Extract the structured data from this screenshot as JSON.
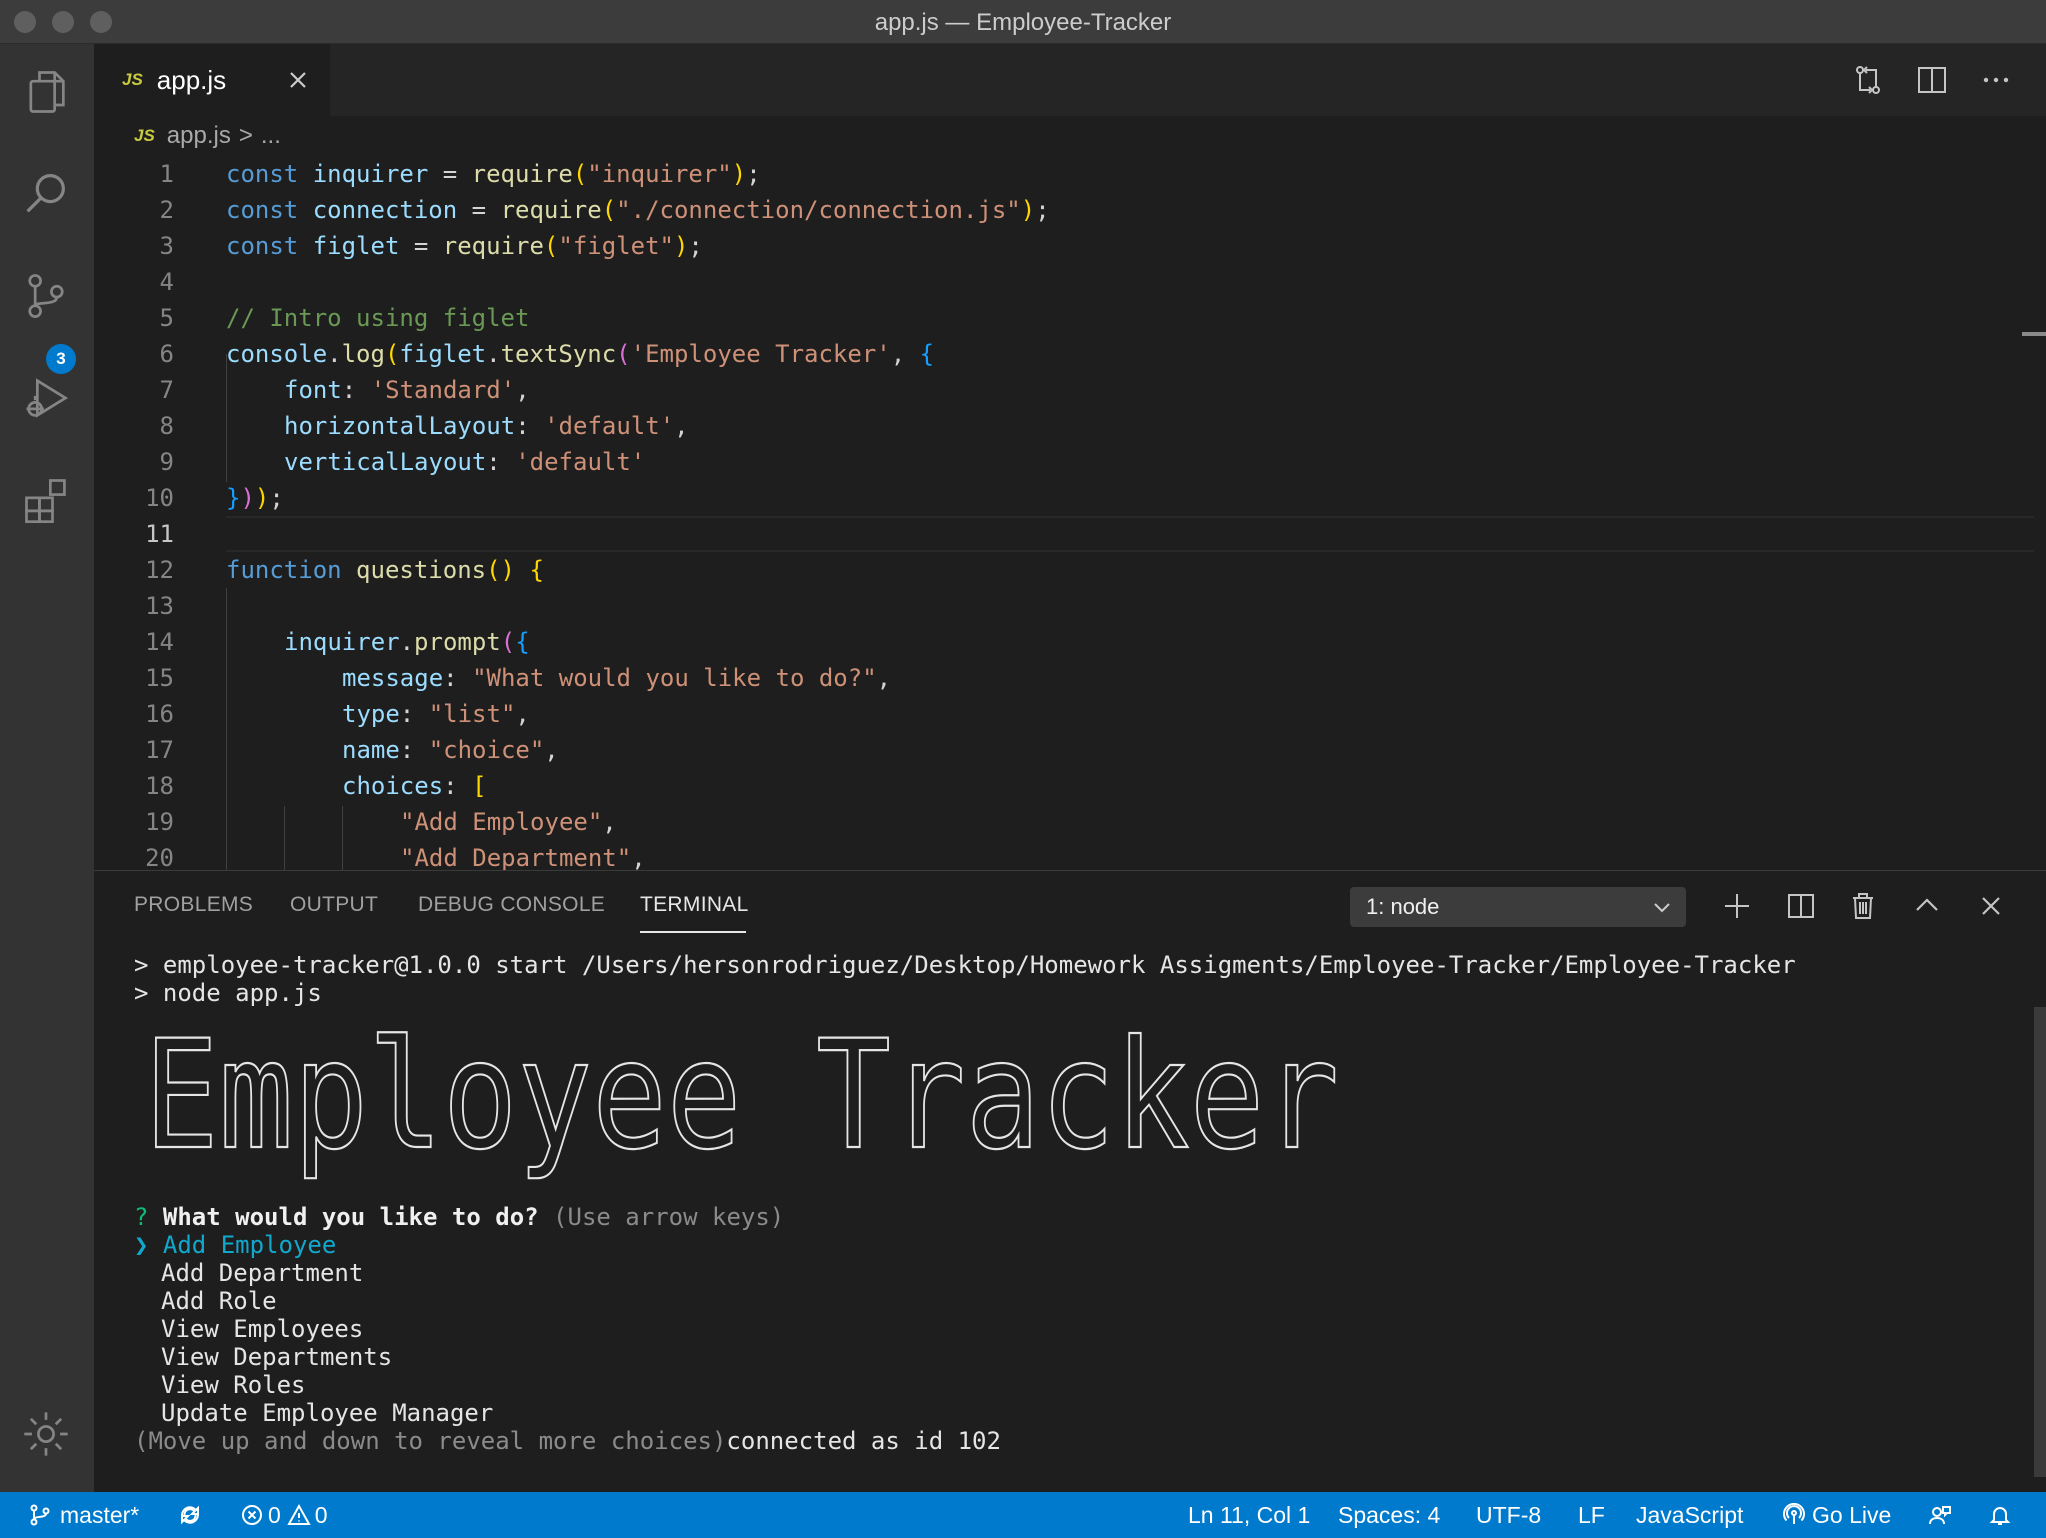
{
  "window": {
    "title": "app.js — Employee-Tracker"
  },
  "activity_bar": {
    "scm_badge": "3"
  },
  "tabs": [
    {
      "label": "app.js",
      "icon": "JS"
    }
  ],
  "breadcrumb": {
    "file": "app.js",
    "sep": ">",
    "more": "..."
  },
  "editor": {
    "lines": [
      {
        "n": "1"
      },
      {
        "n": "2"
      },
      {
        "n": "3"
      },
      {
        "n": "4"
      },
      {
        "n": "5"
      },
      {
        "n": "6"
      },
      {
        "n": "7"
      },
      {
        "n": "8"
      },
      {
        "n": "9"
      },
      {
        "n": "10"
      },
      {
        "n": "11"
      },
      {
        "n": "12"
      },
      {
        "n": "13"
      },
      {
        "n": "14"
      },
      {
        "n": "15"
      },
      {
        "n": "16"
      },
      {
        "n": "17"
      },
      {
        "n": "18"
      },
      {
        "n": "19"
      },
      {
        "n": "20"
      }
    ],
    "code": {
      "l1": [
        "const",
        "inquirer",
        "=",
        "require",
        "(",
        "\"inquirer\"",
        ")",
        ";"
      ],
      "l2": [
        "const",
        "connection",
        "=",
        "require",
        "(",
        "\"./connection/connection.js\"",
        ")",
        ";"
      ],
      "l3": [
        "const",
        "figlet",
        "=",
        "require",
        "(",
        "\"figlet\"",
        ")",
        ";"
      ],
      "l5": "// Intro using figlet",
      "l6": [
        "console",
        ".",
        "log",
        "(",
        "figlet",
        ".",
        "textSync",
        "(",
        "'Employee Tracker'",
        ", ",
        "{"
      ],
      "l7": [
        "font",
        ":",
        "'Standard'",
        ","
      ],
      "l8": [
        "horizontalLayout",
        ":",
        "'default'",
        ","
      ],
      "l9": [
        "verticalLayout",
        ":",
        "'default'"
      ],
      "l10": [
        "}",
        ")",
        ")",
        ";"
      ],
      "l12": [
        "function",
        "questions",
        "()",
        " ",
        "{"
      ],
      "l14": [
        "inquirer",
        ".",
        "prompt",
        "(",
        "{"
      ],
      "l15": [
        "message",
        ":",
        "\"What would you like to do?\"",
        ","
      ],
      "l16": [
        "type",
        ":",
        "\"list\"",
        ","
      ],
      "l17": [
        "name",
        ":",
        "\"choice\"",
        ","
      ],
      "l18": [
        "choices",
        ":",
        "["
      ],
      "l19": [
        "\"Add Employee\"",
        ","
      ],
      "l20": [
        "\"Add Department\"",
        ","
      ]
    }
  },
  "panel": {
    "tabs": [
      "PROBLEMS",
      "OUTPUT",
      "DEBUG CONSOLE",
      "TERMINAL"
    ],
    "active_tab": "TERMINAL",
    "terminal_select": "1: node"
  },
  "terminal": {
    "cmd1": "> employee-tracker@1.0.0 start /Users/hersonrodriguez/Desktop/Homework Assigments/Employee-Tracker/Employee-Tracker",
    "cmd2": "> node app.js",
    "banner": "Employee Tracker",
    "q_mark": "?",
    "question": "What would you like to do?",
    "hint": "(Use arrow keys)",
    "pointer": "❯",
    "choices": [
      "Add Employee",
      "Add Department",
      "Add Role",
      "View Employees",
      "View Departments",
      "View Roles",
      "Update Employee Manager"
    ],
    "footer_hint": "(Move up and down to reveal more choices)",
    "footer_msg": "connected as id 102"
  },
  "status_bar": {
    "branch": "master*",
    "errors": "0",
    "warnings": "0",
    "position": "Ln 11, Col 1",
    "spaces": "Spaces: 4",
    "encoding": "UTF-8",
    "eol": "LF",
    "language": "JavaScript",
    "golive": "Go Live"
  },
  "colors": {
    "accent": "#007acc",
    "editor_bg": "#1e1e1e",
    "activity_bg": "#333333",
    "tab_bar": "#252526"
  }
}
